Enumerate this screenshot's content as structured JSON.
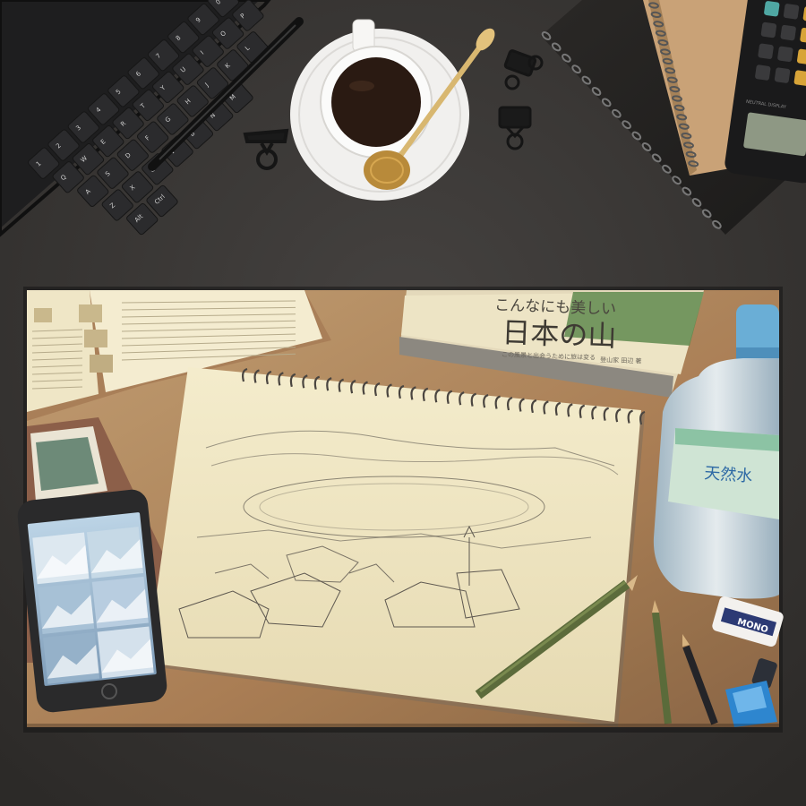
{
  "desk": {
    "keyboard": {
      "keys": [
        "1",
        "2",
        "3",
        "4",
        "5",
        "6",
        "7",
        "8",
        "9",
        "0",
        "Q",
        "W",
        "E",
        "R",
        "T",
        "Y",
        "U",
        "I",
        "O",
        "P",
        "A",
        "S",
        "D",
        "F",
        "G",
        "H",
        "J",
        "K",
        "L",
        "Z",
        "X",
        "C",
        "V",
        "B",
        "N",
        "M",
        "Alt",
        "Ctrl"
      ]
    },
    "calculator": {
      "label": "NEUTRAL DISPLAY"
    },
    "colors": {
      "desk": "#3a3836",
      "paper_tray": "#e9dfb8",
      "wood": "#b8936a"
    }
  },
  "mousepad": {
    "book": {
      "title_line1": "こんなにも美しい",
      "title_line2": "日本の山",
      "subtitle": "この風景と出会うために旅は変る",
      "author": "登山家 田辺 著"
    },
    "bottle_label": "天然水",
    "eraser_label": "MONO"
  }
}
